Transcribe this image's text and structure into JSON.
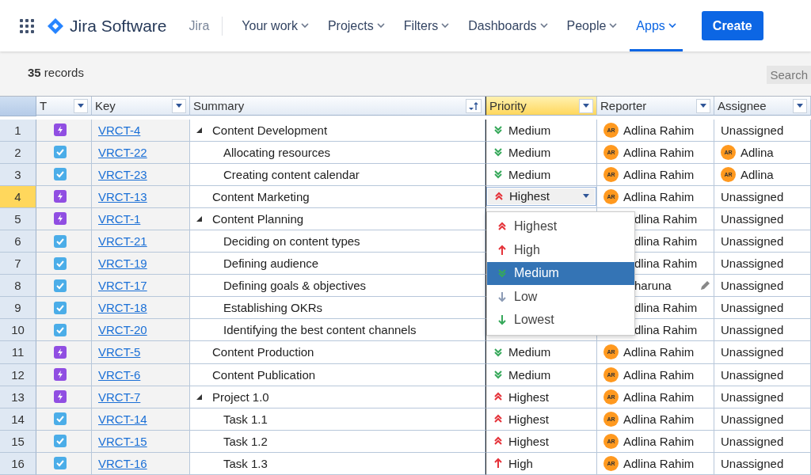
{
  "topbar": {
    "product": "Jira Software",
    "site": "Jira",
    "nav": [
      {
        "label": "Your work",
        "selected": false
      },
      {
        "label": "Projects",
        "selected": false
      },
      {
        "label": "Filters",
        "selected": false
      },
      {
        "label": "Dashboards",
        "selected": false
      },
      {
        "label": "People",
        "selected": false
      },
      {
        "label": "Apps",
        "selected": true
      }
    ],
    "create_button": "Create"
  },
  "toolbar": {
    "count": "35",
    "count_label": "records",
    "search": "Search"
  },
  "table": {
    "columns": [
      {
        "label": "T",
        "kind": "filter",
        "selected": false
      },
      {
        "label": "Key",
        "kind": "filter",
        "selected": false
      },
      {
        "label": "Summary",
        "kind": "sort",
        "selected": false
      },
      {
        "label": "Priority",
        "kind": "filter",
        "selected": true
      },
      {
        "label": "Reporter",
        "kind": "filter",
        "selected": false
      },
      {
        "label": "Assignee",
        "kind": "filter",
        "selected": false
      }
    ],
    "rows": [
      {
        "num": "1",
        "kind": "epic",
        "key": "VRCT-4",
        "summary": "Content Development",
        "expanded": true,
        "selected": false,
        "priority": {
          "kind": "medium",
          "label": "Medium"
        },
        "reporter": {
          "initials": "AR",
          "name": "Adlina Rahim",
          "covered": false
        },
        "assignee": {
          "name": "Unassigned"
        },
        "children": [
          {
            "num": "2",
            "kind": "task",
            "key": "VRCT-22",
            "summary": "Allocating resources",
            "selected": false,
            "priority": {
              "kind": "medium",
              "label": "Medium"
            },
            "reporter": {
              "initials": "AR",
              "name": "Adlina Rahim",
              "covered": false
            },
            "assignee": {
              "initials": "AR",
              "name": "Adlina"
            }
          },
          {
            "num": "3",
            "kind": "task",
            "key": "VRCT-23",
            "summary": "Creating content calendar",
            "selected": false,
            "priority": {
              "kind": "medium",
              "label": "Medium"
            },
            "reporter": {
              "initials": "AR",
              "name": "Adlina Rahim",
              "covered": false
            },
            "assignee": {
              "initials": "AR",
              "name": "Adlina"
            }
          }
        ]
      },
      {
        "num": "4",
        "kind": "epic",
        "key": "VRCT-13",
        "summary": "Content Marketing",
        "selected": true,
        "priority": {
          "kind": "highest",
          "label": "Highest",
          "editing": true
        },
        "reporter": {
          "initials": "AR",
          "name": "Adlina Rahim",
          "covered": false
        },
        "assignee": {
          "name": "Unassigned"
        }
      },
      {
        "num": "5",
        "kind": "epic",
        "key": "VRCT-1",
        "summary": "Content Planning",
        "expanded": true,
        "selected": false,
        "reporter": {
          "name": "dlina Rahim",
          "covered": true
        },
        "assignee": {
          "name": "Unassigned"
        },
        "children": [
          {
            "num": "6",
            "kind": "task",
            "key": "VRCT-21",
            "summary": "Deciding on content types",
            "selected": false,
            "reporter": {
              "name": "dlina Rahim",
              "covered": true
            },
            "assignee": {
              "name": "Unassigned"
            }
          },
          {
            "num": "7",
            "kind": "task",
            "key": "VRCT-19",
            "summary": "Defining audience",
            "selected": false,
            "reporter": {
              "name": "dlina Rahim",
              "covered": true
            },
            "assignee": {
              "name": "Unassigned"
            }
          },
          {
            "num": "8",
            "kind": "task",
            "key": "VRCT-17",
            "summary": "Defining goals & objectives",
            "selected": false,
            "reporter": {
              "name": "haruna",
              "covered": true,
              "edit_icon": true
            },
            "assignee": {
              "name": "Unassigned"
            }
          },
          {
            "num": "9",
            "kind": "task",
            "key": "VRCT-18",
            "summary": "Establishing OKRs",
            "selected": false,
            "reporter": {
              "name": "dlina Rahim",
              "covered": true
            },
            "assignee": {
              "name": "Unassigned"
            }
          },
          {
            "num": "10",
            "kind": "task",
            "key": "VRCT-20",
            "summary": "Identifying the best content channels",
            "selected": false,
            "reporter": {
              "name": "dlina Rahim",
              "covered": true
            },
            "assignee": {
              "name": "Unassigned"
            }
          }
        ]
      },
      {
        "num": "11",
        "kind": "epic",
        "key": "VRCT-5",
        "summary": "Content Production",
        "selected": false,
        "priority": {
          "kind": "medium",
          "label": "Medium"
        },
        "reporter": {
          "initials": "AR",
          "name": "Adlina Rahim",
          "covered": false
        },
        "assignee": {
          "name": "Unassigned"
        }
      },
      {
        "num": "12",
        "kind": "epic",
        "key": "VRCT-6",
        "summary": "Content Publication",
        "selected": false,
        "priority": {
          "kind": "medium",
          "label": "Medium"
        },
        "reporter": {
          "initials": "AR",
          "name": "Adlina Rahim",
          "covered": false
        },
        "assignee": {
          "name": "Unassigned"
        }
      },
      {
        "num": "13",
        "kind": "epic",
        "key": "VRCT-7",
        "summary": "Project 1.0",
        "expanded": true,
        "selected": false,
        "priority": {
          "kind": "highest",
          "label": "Highest"
        },
        "reporter": {
          "initials": "AR",
          "name": "Adlina Rahim",
          "covered": false
        },
        "assignee": {
          "name": "Unassigned"
        },
        "children": [
          {
            "num": "14",
            "kind": "task",
            "key": "VRCT-14",
            "summary": "Task 1.1",
            "selected": false,
            "priority": {
              "kind": "highest",
              "label": "Highest"
            },
            "reporter": {
              "initials": "AR",
              "name": "Adlina Rahim",
              "covered": false
            },
            "assignee": {
              "name": "Unassigned"
            }
          },
          {
            "num": "15",
            "kind": "task",
            "key": "VRCT-15",
            "summary": "Task 1.2",
            "selected": false,
            "priority": {
              "kind": "highest",
              "label": "Highest"
            },
            "reporter": {
              "initials": "AR",
              "name": "Adlina Rahim",
              "covered": false
            },
            "assignee": {
              "name": "Unassigned"
            }
          },
          {
            "num": "16",
            "kind": "task",
            "key": "VRCT-16",
            "summary": "Task 1.3",
            "selected": false,
            "priority": {
              "kind": "high",
              "label": "High"
            },
            "reporter": {
              "initials": "AR",
              "name": "Adlina Rahim",
              "covered": false
            },
            "assignee": {
              "name": "Unassigned"
            }
          }
        ]
      }
    ]
  },
  "priority_menu": [
    {
      "kind": "highest",
      "label": "Highest",
      "selected": false
    },
    {
      "kind": "high",
      "label": "High",
      "selected": false
    },
    {
      "kind": "medium",
      "label": "Medium",
      "selected": true
    },
    {
      "kind": "low",
      "label": "Low",
      "selected": false
    },
    {
      "kind": "lowest",
      "label": "Lowest",
      "selected": false
    }
  ]
}
